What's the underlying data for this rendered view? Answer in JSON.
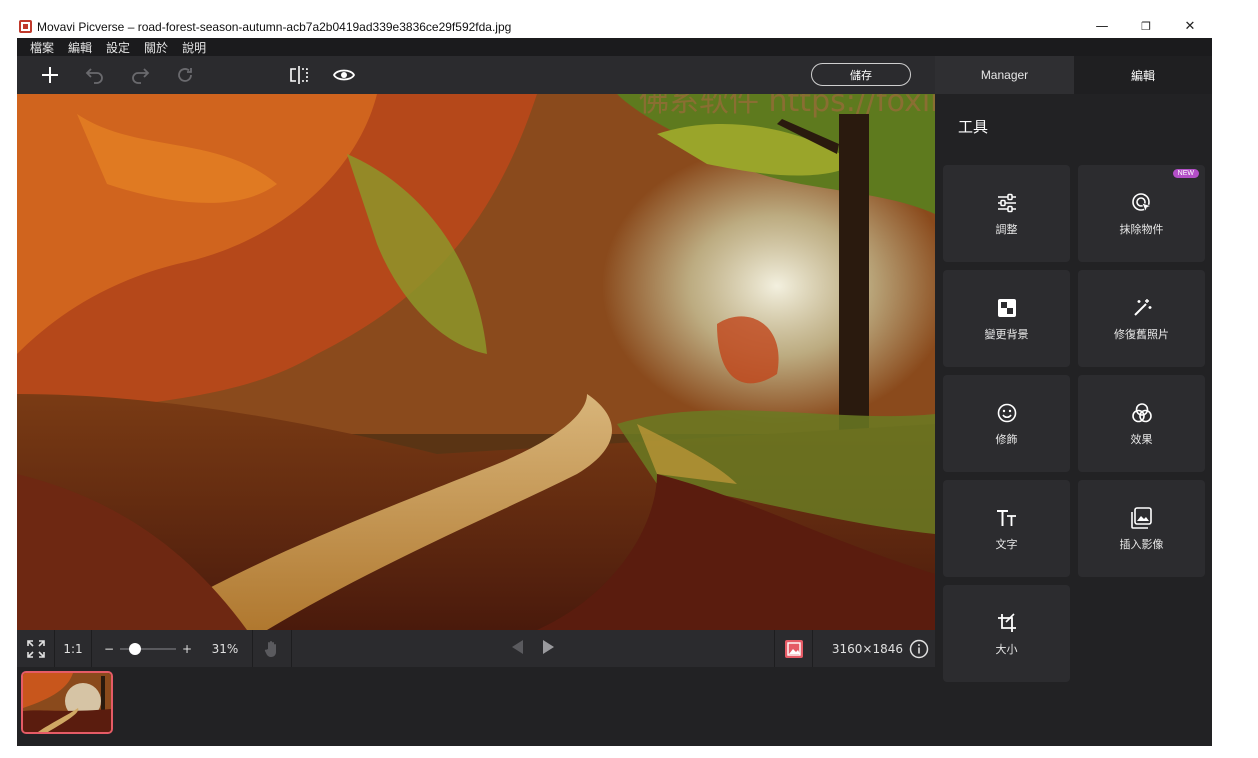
{
  "window": {
    "title": "Movavi Picverse – road-forest-season-autumn-acb7a2b0419ad339e3836ce29f592fda.jpg",
    "minimize": "—",
    "maximize": "❐",
    "close": "✕"
  },
  "menu": [
    "檔案",
    "編輯",
    "設定",
    "關於",
    "說明"
  ],
  "toolbar": {
    "add_icon": "plus-icon",
    "undo_icon": "undo-icon",
    "redo_icon": "redo-icon",
    "reset_icon": "reset-icon",
    "compare_icon": "compare-icon",
    "preview_icon": "eye-icon",
    "save_label": "儲存"
  },
  "tabs": {
    "manager": "Manager",
    "edit": "編輯"
  },
  "panel": {
    "title": "工具",
    "tools": [
      {
        "label": "調整",
        "icon": "sliders-icon"
      },
      {
        "label": "抹除物件",
        "icon": "eraser-cursor-icon",
        "badge": "NEW"
      },
      {
        "label": "變更背景",
        "icon": "background-icon"
      },
      {
        "label": "修復舊照片",
        "icon": "magic-wand-icon"
      },
      {
        "label": "修飾",
        "icon": "smile-icon"
      },
      {
        "label": "效果",
        "icon": "effects-icon"
      },
      {
        "label": "文字",
        "icon": "text-icon"
      },
      {
        "label": "插入影像",
        "icon": "insert-image-icon"
      },
      {
        "label": "大小",
        "icon": "crop-icon"
      }
    ]
  },
  "bottombar": {
    "fit_icon": "fit-screen-icon",
    "one_to_one": "1:1",
    "zoom_minus": "−",
    "zoom_plus": "+",
    "zoom_value": "31%",
    "zoom_level": 0.2,
    "hand_icon": "hand-icon",
    "prev_icon": "prev-arrow-icon",
    "next_icon": "next-arrow-icon",
    "image_icon": "image-icon",
    "dimensions": "3160×1846",
    "info_icon": "info-icon"
  },
  "watermark": "佛系软件 https://foxirj.com",
  "colors": {
    "accent": "#e55b66",
    "badge": "#b34fc7"
  }
}
